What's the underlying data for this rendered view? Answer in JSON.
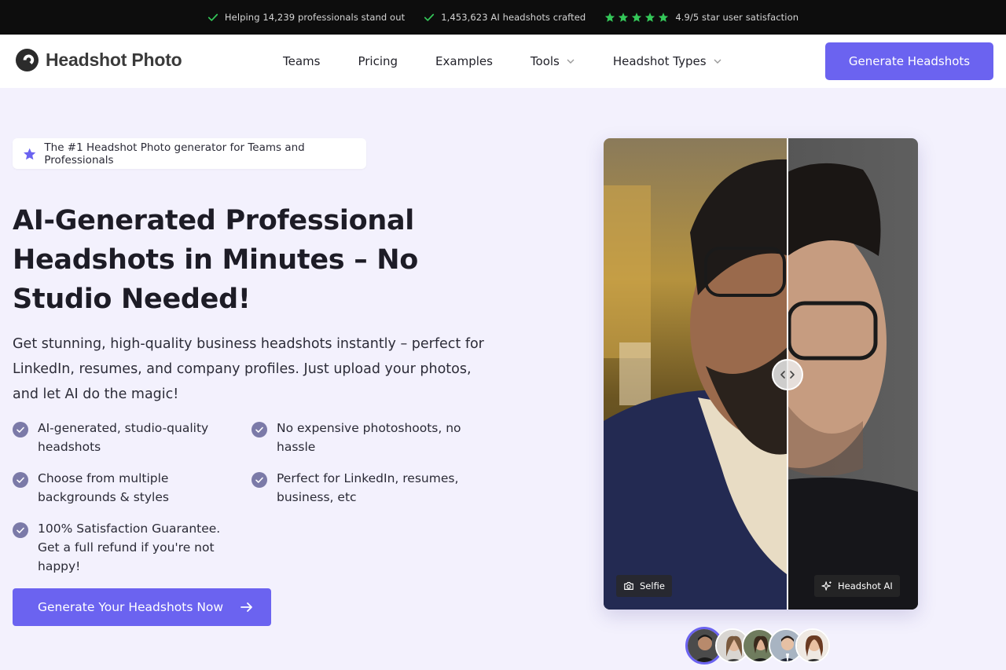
{
  "topbar": {
    "items": [
      {
        "icon": "check-icon",
        "text": "Helping 14,239 professionals stand out"
      },
      {
        "icon": "check-icon",
        "text": "1,453,623 AI headshots crafted"
      },
      {
        "icon": "star-icon",
        "text": "4.9/5 star user satisfaction",
        "stars": 5
      }
    ],
    "accent": "#34c759"
  },
  "nav": {
    "brand": "Headshot Photo",
    "links": [
      "Teams",
      "Pricing",
      "Examples",
      "Tools",
      "Headshot Types"
    ],
    "cta": "Generate Headshots"
  },
  "hero": {
    "pill": "The #1 Headshot Photo generator for Teams and Professionals",
    "title": "AI-Generated Professional Headshots in Minutes – No Studio Needed!",
    "subtitle": "Get stunning, high-quality business headshots instantly – perfect for LinkedIn, resumes, and company profiles. Just upload your photos, and let AI do the magic!",
    "features": [
      "AI-generated, studio-quality headshots",
      "No expensive photoshoots, no hassle",
      "Choose from multiple backgrounds & styles",
      "Perfect for LinkedIn, resumes, business, etc",
      "100% Satisfaction Guarantee. Get a full refund if you're not happy!"
    ],
    "cta": "Generate Your Headshots Now"
  },
  "compare": {
    "left_label": "Selfie",
    "right_label": "Headshot AI"
  },
  "colors": {
    "primary": "#6b63f0",
    "background": "#f3f1fd"
  }
}
